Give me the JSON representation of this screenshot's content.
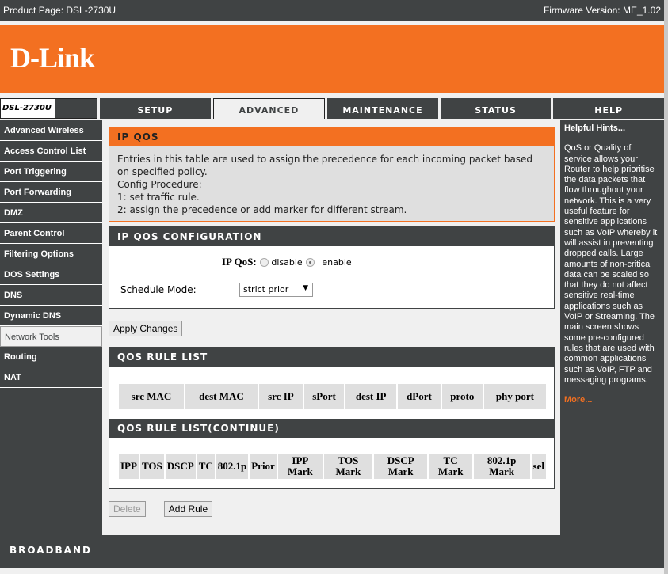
{
  "topbar": {
    "product": "Product Page: DSL-2730U",
    "firmware": "Firmware Version: ME_1.02"
  },
  "logo": "D-Link",
  "model": "DSL-2730U",
  "tabs": [
    "SETUP",
    "ADVANCED",
    "MAINTENANCE",
    "STATUS",
    "HELP"
  ],
  "active_tab": "ADVANCED",
  "sidebar": [
    "Advanced Wireless",
    "Access Control List",
    "Port Triggering",
    "Port Forwarding",
    "DMZ",
    "Parent Control",
    "Filtering Options",
    "DOS Settings",
    "DNS",
    "Dynamic DNS",
    "Network Tools",
    "Routing",
    "NAT"
  ],
  "active_sidebar": "Network Tools",
  "intro": {
    "title": "IP QOS",
    "lines": [
      "Entries in this table are used to assign the precedence for each incoming packet based on specified policy.",
      "Config Procedure:",
      "1: set traffic rule.",
      "2: assign the precedence or add marker for different stream."
    ]
  },
  "config": {
    "title": "IP QOS CONFIGURATION",
    "ipqos_label": "IP QoS:",
    "disable": "disable",
    "enable": "enable",
    "selected": "enable",
    "schedule_label": "Schedule Mode:",
    "schedule_value": "strict prior",
    "apply": "Apply Changes"
  },
  "rules": {
    "title": "QOS RULE LIST",
    "columns": [
      "src MAC",
      "dest MAC",
      "src IP",
      "sPort",
      "dest IP",
      "dPort",
      "proto",
      "phy port"
    ]
  },
  "rules2": {
    "title": "QOS RULE LIST(CONTINUE)",
    "columns": [
      "IPP",
      "TOS",
      "DSCP",
      "TC",
      "802.1p",
      "Prior",
      "IPP Mark",
      "TOS Mark",
      "DSCP Mark",
      "TC Mark",
      "802.1p Mark",
      "sel"
    ]
  },
  "buttons": {
    "delete": "Delete",
    "add": "Add Rule"
  },
  "hints": {
    "title": "Helpful Hints...",
    "text": "QoS or Quality of service allows your Router to help prioritise the data packets that flow throughout your network. This is a very useful feature for sensitive applications such as VoIP whereby it will assist in preventing dropped calls. Large amounts of non-critical data can be scaled so that they do not affect sensitive real-time applications such as VoIP or Streaming. The main screen shows some pre-configured rules that are used with common applications such as VoIP, FTP and messaging programs.",
    "more": "More..."
  },
  "footer": "BROADBAND",
  "colors": {
    "orange": "#f37021",
    "dark": "#404344"
  }
}
